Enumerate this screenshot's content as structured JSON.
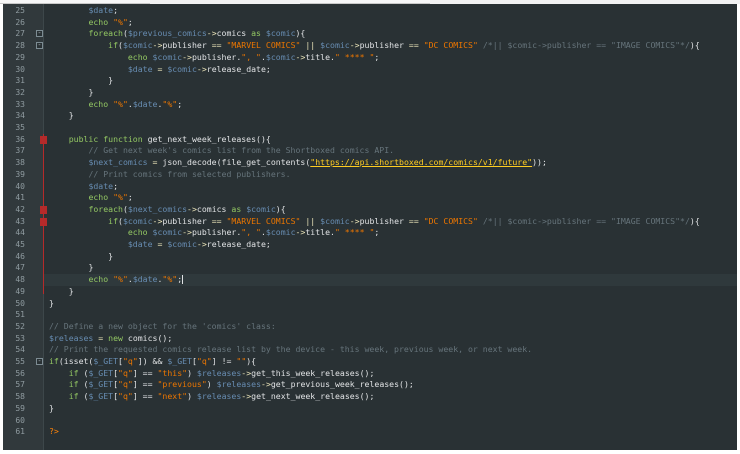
{
  "editor": {
    "colors": {
      "background": "#293134",
      "default": "#e0e2e4",
      "keyword": "#93c763",
      "variable": "#678cb1",
      "string": "#ec7600",
      "comment": "#66747b",
      "url": "#ffcd22",
      "operator": "#e8e2b7",
      "tag": "#ff8409"
    },
    "lines": [
      {
        "num": "25",
        "tokens": [
          [
            "        ",
            "d"
          ],
          [
            "$date",
            "v"
          ],
          [
            ";",
            "d"
          ]
        ]
      },
      {
        "num": "26",
        "tokens": [
          [
            "        ",
            "d"
          ],
          [
            "echo",
            "k"
          ],
          [
            " ",
            "d"
          ],
          [
            "\"%\"",
            "s"
          ],
          [
            ";",
            "d"
          ]
        ]
      },
      {
        "num": "27",
        "fold": "-",
        "tokens": [
          [
            "        ",
            "d"
          ],
          [
            "foreach",
            "k"
          ],
          [
            "(",
            "d"
          ],
          [
            "$previous_comics",
            "v"
          ],
          [
            "->",
            "o"
          ],
          [
            "comics",
            "d"
          ],
          [
            " as ",
            "k"
          ],
          [
            "$comic",
            "v"
          ],
          [
            "){",
            "d"
          ]
        ]
      },
      {
        "num": "28",
        "fold": "-",
        "tokens": [
          [
            "            ",
            "d"
          ],
          [
            "if",
            "k"
          ],
          [
            "(",
            "d"
          ],
          [
            "$comic",
            "v"
          ],
          [
            "->",
            "o"
          ],
          [
            "publisher",
            "d"
          ],
          [
            " == ",
            "o"
          ],
          [
            "\"MARVEL COMICS\"",
            "s"
          ],
          [
            " || ",
            "o"
          ],
          [
            "$comic",
            "v"
          ],
          [
            "->",
            "o"
          ],
          [
            "publisher",
            "d"
          ],
          [
            " == ",
            "o"
          ],
          [
            "\"DC COMICS\"",
            "s"
          ],
          [
            " /*|| ",
            "c"
          ],
          [
            "$comic->publisher == \"IMAGE COMICS\"*/",
            "c"
          ],
          [
            "){",
            "d"
          ]
        ]
      },
      {
        "num": "29",
        "tokens": [
          [
            "                ",
            "d"
          ],
          [
            "echo",
            "k"
          ],
          [
            " ",
            "d"
          ],
          [
            "$comic",
            "v"
          ],
          [
            "->",
            "o"
          ],
          [
            "publisher.",
            "d"
          ],
          [
            "\", \"",
            "s"
          ],
          [
            ".",
            "d"
          ],
          [
            "$comic",
            "v"
          ],
          [
            "->",
            "o"
          ],
          [
            "title.",
            "d"
          ],
          [
            "\" **** \"",
            "s"
          ],
          [
            ";",
            "d"
          ]
        ]
      },
      {
        "num": "30",
        "tokens": [
          [
            "                ",
            "d"
          ],
          [
            "$date",
            "v"
          ],
          [
            " = ",
            "o"
          ],
          [
            "$comic",
            "v"
          ],
          [
            "->",
            "o"
          ],
          [
            "release_date;",
            "d"
          ]
        ]
      },
      {
        "num": "31",
        "tokens": [
          [
            "            ",
            "d"
          ],
          [
            "}",
            "d"
          ]
        ]
      },
      {
        "num": "32",
        "tokens": [
          [
            "        ",
            "d"
          ],
          [
            "}",
            "d"
          ]
        ]
      },
      {
        "num": "33",
        "tokens": [
          [
            "        ",
            "d"
          ],
          [
            "echo",
            "k"
          ],
          [
            " ",
            "d"
          ],
          [
            "\"%\"",
            "s"
          ],
          [
            ".",
            "d"
          ],
          [
            "$date",
            "v"
          ],
          [
            ".",
            "d"
          ],
          [
            "\"%\"",
            "s"
          ],
          [
            ";",
            "d"
          ]
        ]
      },
      {
        "num": "34",
        "tokens": [
          [
            "    ",
            "d"
          ],
          [
            "}",
            "d"
          ]
        ]
      },
      {
        "num": "35",
        "tokens": []
      },
      {
        "num": "36",
        "bp": true,
        "tokens": [
          [
            "    ",
            "d"
          ],
          [
            "public function",
            "k"
          ],
          [
            " get_next_week_releases(){",
            "d"
          ]
        ]
      },
      {
        "num": "37",
        "tokens": [
          [
            "        ",
            "d"
          ],
          [
            "// Get next week's comics list from the Shortboxed comics API.",
            "c"
          ]
        ]
      },
      {
        "num": "38",
        "tokens": [
          [
            "        ",
            "d"
          ],
          [
            "$next_comics",
            "v"
          ],
          [
            " = ",
            "o"
          ],
          [
            "json_decode(file_get_contents(",
            "d"
          ],
          [
            "\"https://api.shortboxed.com/comics/v1/future\"",
            "u"
          ],
          [
            "));",
            "d"
          ]
        ]
      },
      {
        "num": "39",
        "tokens": [
          [
            "        ",
            "d"
          ],
          [
            "// Print comics from selected publishers.",
            "c"
          ]
        ]
      },
      {
        "num": "40",
        "tokens": [
          [
            "        ",
            "d"
          ],
          [
            "$date",
            "v"
          ],
          [
            ";",
            "d"
          ]
        ]
      },
      {
        "num": "41",
        "tokens": [
          [
            "        ",
            "d"
          ],
          [
            "echo",
            "k"
          ],
          [
            " ",
            "d"
          ],
          [
            "\"%\"",
            "s"
          ],
          [
            ";",
            "d"
          ]
        ]
      },
      {
        "num": "42",
        "bp": true,
        "tokens": [
          [
            "        ",
            "d"
          ],
          [
            "foreach",
            "k"
          ],
          [
            "(",
            "d"
          ],
          [
            "$next_comics",
            "v"
          ],
          [
            "->",
            "o"
          ],
          [
            "comics",
            "d"
          ],
          [
            " as ",
            "k"
          ],
          [
            "$comic",
            "v"
          ],
          [
            "){",
            "d"
          ]
        ]
      },
      {
        "num": "43",
        "bp": true,
        "tokens": [
          [
            "            ",
            "d"
          ],
          [
            "if",
            "k"
          ],
          [
            "(",
            "d"
          ],
          [
            "$comic",
            "v"
          ],
          [
            "->",
            "o"
          ],
          [
            "publisher",
            "d"
          ],
          [
            " == ",
            "o"
          ],
          [
            "\"MARVEL COMICS\"",
            "s"
          ],
          [
            " || ",
            "o"
          ],
          [
            "$comic",
            "v"
          ],
          [
            "->",
            "o"
          ],
          [
            "publisher",
            "d"
          ],
          [
            " == ",
            "o"
          ],
          [
            "\"DC COMICS\"",
            "s"
          ],
          [
            " /*|| ",
            "c"
          ],
          [
            "$comic->publisher == \"IMAGE COMICS\"*/",
            "c"
          ],
          [
            "){",
            "d"
          ]
        ]
      },
      {
        "num": "44",
        "tokens": [
          [
            "                ",
            "d"
          ],
          [
            "echo",
            "k"
          ],
          [
            " ",
            "d"
          ],
          [
            "$comic",
            "v"
          ],
          [
            "->",
            "o"
          ],
          [
            "publisher.",
            "d"
          ],
          [
            "\", \"",
            "s"
          ],
          [
            ".",
            "d"
          ],
          [
            "$comic",
            "v"
          ],
          [
            "->",
            "o"
          ],
          [
            "title.",
            "d"
          ],
          [
            "\" **** \"",
            "s"
          ],
          [
            ";",
            "d"
          ]
        ]
      },
      {
        "num": "45",
        "tokens": [
          [
            "                ",
            "d"
          ],
          [
            "$date",
            "v"
          ],
          [
            " = ",
            "o"
          ],
          [
            "$comic",
            "v"
          ],
          [
            "->",
            "o"
          ],
          [
            "release_date;",
            "d"
          ]
        ]
      },
      {
        "num": "46",
        "tokens": [
          [
            "            ",
            "d"
          ],
          [
            "}",
            "d"
          ]
        ]
      },
      {
        "num": "47",
        "tokens": [
          [
            "        ",
            "d"
          ],
          [
            "}",
            "d"
          ]
        ]
      },
      {
        "num": "48",
        "current": true,
        "tokens": [
          [
            "        ",
            "d"
          ],
          [
            "echo",
            "k"
          ],
          [
            " ",
            "d"
          ],
          [
            "\"%\"",
            "s"
          ],
          [
            ".",
            "d"
          ],
          [
            "$date",
            "v"
          ],
          [
            ".",
            "d"
          ],
          [
            "\"%\"",
            "s"
          ],
          [
            ";",
            "d"
          ]
        ]
      },
      {
        "num": "49",
        "tokens": [
          [
            "    ",
            "d"
          ],
          [
            "}",
            "d"
          ]
        ]
      },
      {
        "num": "50",
        "tokens": [
          [
            "}",
            "d"
          ]
        ]
      },
      {
        "num": "51",
        "tokens": []
      },
      {
        "num": "52",
        "tokens": [
          [
            "// Define a new object for the 'comics' class:",
            "c"
          ]
        ]
      },
      {
        "num": "53",
        "tokens": [
          [
            "$releases",
            "v"
          ],
          [
            " = ",
            "o"
          ],
          [
            "new",
            "k"
          ],
          [
            " comics();",
            "d"
          ]
        ]
      },
      {
        "num": "54",
        "tokens": [
          [
            "// Print the requested comics release list by the device - this week, previous week, or next week.",
            "c"
          ]
        ]
      },
      {
        "num": "55",
        "fold": "-",
        "tokens": [
          [
            "if",
            "k"
          ],
          [
            "(isset(",
            "d"
          ],
          [
            "$_GET",
            "v"
          ],
          [
            "[",
            "d"
          ],
          [
            "\"q\"",
            "s"
          ],
          [
            "]) && ",
            "d"
          ],
          [
            "$_GET",
            "v"
          ],
          [
            "[",
            "d"
          ],
          [
            "\"q\"",
            "s"
          ],
          [
            "] != ",
            "d"
          ],
          [
            "\"\"",
            "s"
          ],
          [
            "){",
            "d"
          ]
        ]
      },
      {
        "num": "56",
        "tokens": [
          [
            "    ",
            "d"
          ],
          [
            "if",
            "k"
          ],
          [
            " (",
            "d"
          ],
          [
            "$_GET",
            "v"
          ],
          [
            "[",
            "d"
          ],
          [
            "\"q\"",
            "s"
          ],
          [
            "] == ",
            "d"
          ],
          [
            "\"this\"",
            "s"
          ],
          [
            ") ",
            "d"
          ],
          [
            "$releases",
            "v"
          ],
          [
            "->",
            "o"
          ],
          [
            "get_this_week_releases();",
            "d"
          ]
        ]
      },
      {
        "num": "57",
        "tokens": [
          [
            "    ",
            "d"
          ],
          [
            "if",
            "k"
          ],
          [
            " (",
            "d"
          ],
          [
            "$_GET",
            "v"
          ],
          [
            "[",
            "d"
          ],
          [
            "\"q\"",
            "s"
          ],
          [
            "] == ",
            "d"
          ],
          [
            "\"previous\"",
            "s"
          ],
          [
            ") ",
            "d"
          ],
          [
            "$releases",
            "v"
          ],
          [
            "->",
            "o"
          ],
          [
            "get_previous_week_releases();",
            "d"
          ]
        ]
      },
      {
        "num": "58",
        "tokens": [
          [
            "    ",
            "d"
          ],
          [
            "if",
            "k"
          ],
          [
            " (",
            "d"
          ],
          [
            "$_GET",
            "v"
          ],
          [
            "[",
            "d"
          ],
          [
            "\"q\"",
            "s"
          ],
          [
            "] == ",
            "d"
          ],
          [
            "\"next\"",
            "s"
          ],
          [
            ") ",
            "d"
          ],
          [
            "$releases",
            "v"
          ],
          [
            "->",
            "o"
          ],
          [
            "get_next_week_releases();",
            "d"
          ]
        ]
      },
      {
        "num": "59",
        "tokens": [
          [
            "}",
            "d"
          ]
        ]
      },
      {
        "num": "60",
        "tokens": []
      },
      {
        "num": "61",
        "tokens": [
          [
            "?>",
            "t"
          ]
        ]
      }
    ]
  }
}
